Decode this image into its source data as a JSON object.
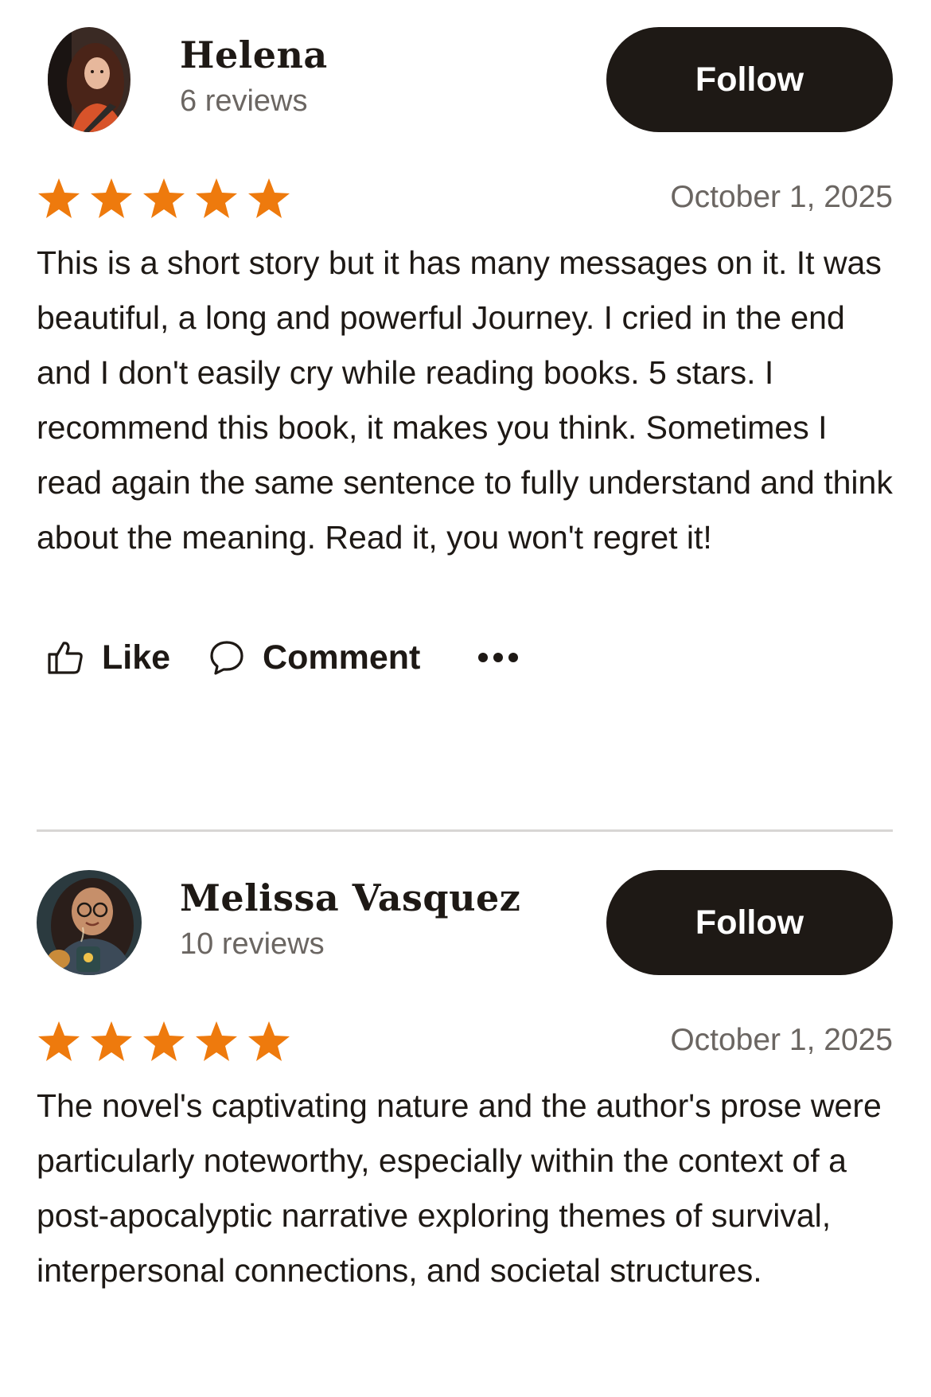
{
  "reviews": [
    {
      "reviewer": {
        "name": "Helena",
        "review_count": "6 reviews"
      },
      "follow_label": "Follow",
      "rating": 5,
      "rating_max": 5,
      "date": "October 1, 2025",
      "body": "This is a short story but it has many messages on it. It was beautiful, a long and powerful Journey. I cried in the end and I don't easily cry while reading books. 5 stars. I recommend this book, it makes you think. Sometimes I read again the same sentence to fully understand and think about the meaning. Read it, you won't regret it!",
      "actions": {
        "like_label": "Like",
        "comment_label": "Comment"
      }
    },
    {
      "reviewer": {
        "name": "Melissa Vasquez",
        "review_count": "10 reviews"
      },
      "follow_label": "Follow",
      "rating": 5,
      "rating_max": 5,
      "date": "October 1, 2025",
      "body": "The novel's captivating nature and the author's prose were particularly noteworthy, especially within the context of a post-apocalyptic narrative exploring themes of survival, interpersonal connections, and societal structures."
    }
  ],
  "colors": {
    "star": "#ee7a0d",
    "button_bg": "#1e1915",
    "text": "#1e1915",
    "muted_text": "#6b6662",
    "divider": "#d8d6d4"
  },
  "icons": [
    "thumbs-up-icon",
    "comment-bubble-icon",
    "more-options-icon",
    "star-icon"
  ]
}
